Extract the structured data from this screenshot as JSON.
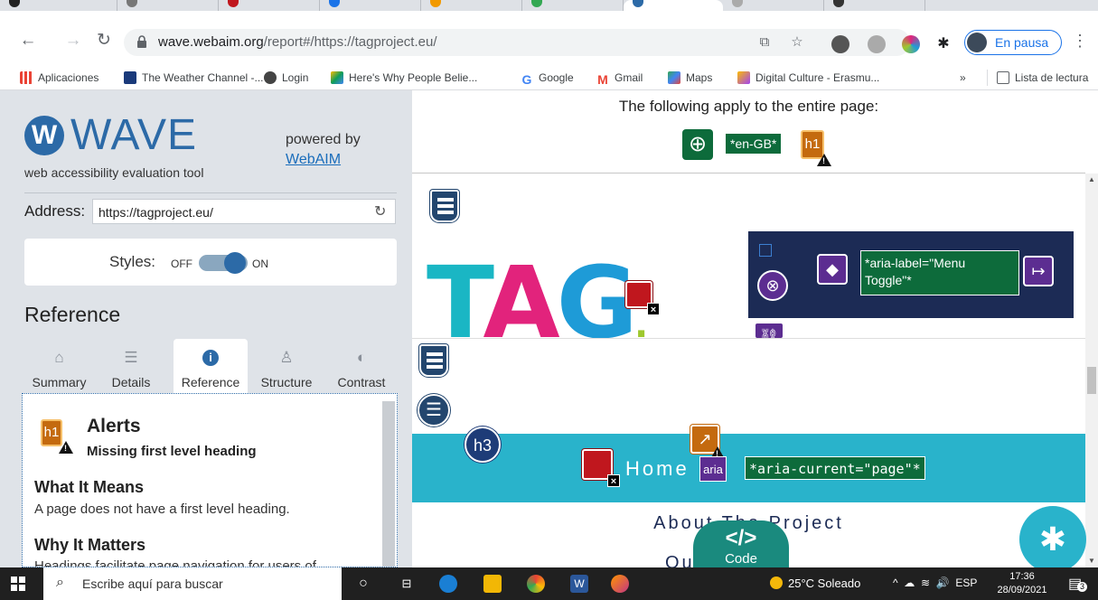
{
  "browser": {
    "url_host": "wave.webaim.org",
    "url_path": "/report#/https://tagproject.eu/",
    "profile_label": "En pausa"
  },
  "bookmarks": [
    {
      "label": "Aplicaciones",
      "color": "#ea4335"
    },
    {
      "label": "The Weather Channel -...",
      "color": "#1a3a7a"
    },
    {
      "label": "Login",
      "color": "#444"
    },
    {
      "label": "Here's Why People Belie...",
      "color": "#0f9d58"
    },
    {
      "label": "Google",
      "color": "#4285f4"
    },
    {
      "label": "Gmail",
      "color": "#ea4335"
    },
    {
      "label": "Maps",
      "color": "#34a853"
    },
    {
      "label": "Digital Culture - Erasmu...",
      "color": "#a142f4"
    }
  ],
  "bookmarks_more": "»",
  "reading_list": "Lista de lectura",
  "wave": {
    "logo_letter": "W",
    "logo_text": "WAVE",
    "tagline": "web accessibility evaluation tool",
    "powered_by": "powered by",
    "powered_link": "WebAIM",
    "address_label": "Address:",
    "address_value": "https://tagproject.eu/",
    "styles_label": "Styles:",
    "styles_off": "OFF",
    "styles_on": "ON",
    "reference_title": "Reference",
    "tabs": [
      {
        "label": "Summary",
        "icon": "home-icon"
      },
      {
        "label": "Details",
        "icon": "list-icon"
      },
      {
        "label": "Reference",
        "icon": "info-icon",
        "active": true
      },
      {
        "label": "Structure",
        "icon": "sitemap-icon"
      },
      {
        "label": "Contrast",
        "icon": "contrast-icon"
      }
    ],
    "panel": {
      "badge": "h1",
      "alerts_title": "Alerts",
      "alert_name": "Missing first level heading",
      "what_means_title": "What It Means",
      "what_means_body": "A page does not have a first level heading.",
      "why_matters_title": "Why It Matters",
      "why_matters_body": "Headings facilitate page navigation for users of"
    }
  },
  "preview": {
    "applies_text": "The following apply to the entire page:",
    "lang_badge": "*en-GB*",
    "h1_badge": "h1",
    "aria_label_text": "*aria-label=\"Menu Toggle\"*",
    "h3_badge": "h3",
    "home_text": "Home",
    "aria_badge": "aria",
    "aria_current_text": "*aria-current=\"page\"*",
    "about_text": "About The Project",
    "ers_text": "Ou         ers",
    "code_glyph": "</>",
    "code_label": "Code",
    "logo_letters": [
      "T",
      "A",
      "G",
      "."
    ]
  },
  "taskbar": {
    "search_placeholder": "Escribe aquí para buscar",
    "weather": "25°C Soleado",
    "lang": "ESP",
    "time": "17:36",
    "date": "28/09/2021",
    "notif_count": "3"
  },
  "colors": {
    "wave_blue": "#2c6aa7",
    "alert_orange": "#c46a0f",
    "aria_green": "#0d6b3b",
    "aria_purple": "#5c2d91",
    "error_red": "#c0171e",
    "teal": "#29b3cb"
  }
}
